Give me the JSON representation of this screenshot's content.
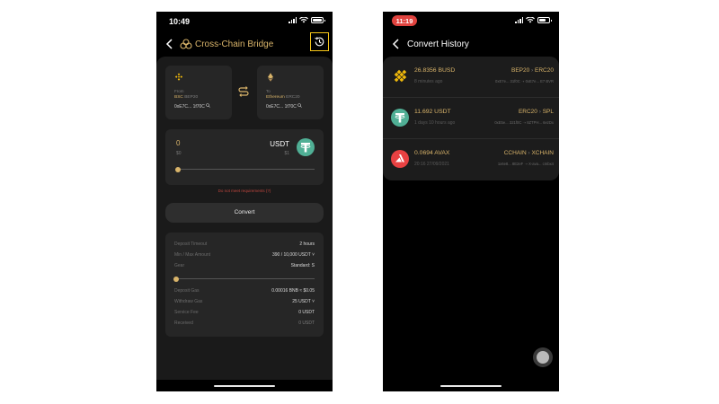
{
  "left_screen": {
    "status_time": "10:49",
    "header_title": "Cross-Chain Bridge",
    "from": {
      "direction": "From",
      "chain": "BSC",
      "standard": "BEP20",
      "address": "0xE7C... 1f70C"
    },
    "to": {
      "direction": "To",
      "chain": "Ethereum",
      "standard": "ERC20",
      "address": "0xE7C... 1f70C"
    },
    "amount": {
      "value": "0",
      "usd": "$0",
      "token": "USDT",
      "token_usd": "$1",
      "slider_fraction": 0
    },
    "error": "Do not meet requirements (?)",
    "convert_label": "Convert",
    "details": {
      "deposit_timeout": {
        "label": "Deposit Timeout",
        "value": "2 hours"
      },
      "min_max": {
        "label": "Min / Max Amount",
        "value": "390 / 10,000 USDT ˅"
      },
      "gear": {
        "label": "Gear",
        "value": "Standard: S"
      },
      "gear_slider_fraction": 0,
      "deposit_gas": {
        "label": "Deposit Gas",
        "value": "0.00016 BNB ≈ $0.05"
      },
      "withdraw_gas": {
        "label": "Withdraw Gas",
        "value": "25 USDT ˅"
      },
      "service_fee": {
        "label": "Service Fee",
        "value": "0 USDT"
      },
      "received": {
        "label": "Received",
        "value": "0 USDT"
      }
    }
  },
  "right_screen": {
    "status_time": "11:19",
    "header_title": "Convert History",
    "items": [
      {
        "amount": "26.8356 BUSD",
        "time": "8 minutes ago",
        "from_std": "BEP20",
        "to_std": "ERC20",
        "addresses": "0xE7e... 31f0C ➝ 0xE7e... E7 BVR",
        "icon": "busd-icon"
      },
      {
        "amount": "11.692 USDT",
        "time": "1 days 10 hours ago",
        "from_std": "ERC20",
        "to_std": "SPL",
        "addresses": "0xE5e... 321f0C ➝ 8ZTPH... 6ezDx",
        "icon": "tether-icon"
      },
      {
        "amount": "0.0694 AVAX",
        "time": "20:16 27/09/2021",
        "from_std": "CCHAIN",
        "to_std": "XCHAIN",
        "addresses": "1x6e8... 8E2eF ➝ X-ava... cmbx4",
        "icon": "avax-icon"
      }
    ]
  },
  "colors": {
    "accent_gold": "#d9b46a",
    "highlight_yellow": "#f5c518",
    "tether_green": "#50af95",
    "avax_red": "#e84142",
    "binance_gold": "#f0b90b"
  }
}
